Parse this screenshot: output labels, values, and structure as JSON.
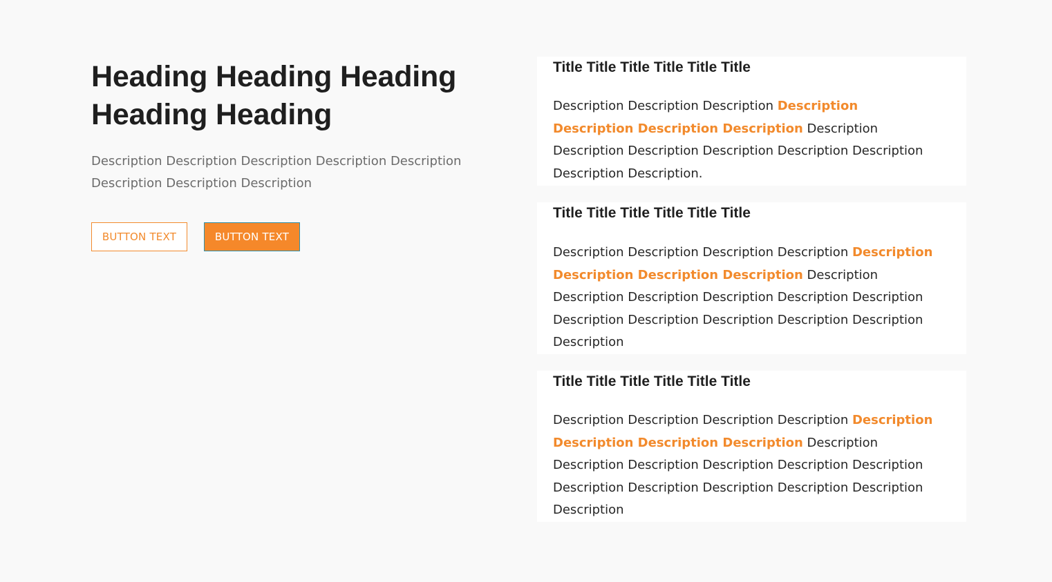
{
  "hero": {
    "heading": "Heading Heading Heading Heading Heading",
    "description": "Description Description Description Description Description Description Description Description",
    "button_outline_label": "BUTTON TEXT",
    "button_filled_label": "BUTTON TEXT"
  },
  "cards": [
    {
      "title": "Title Title Title Title Title Title",
      "desc_lead": "Description Description Description",
      "desc_highlight": "Description Description Description Description",
      "desc_rest": "Description Description Description Description Description Description Description Description."
    },
    {
      "title": "Title Title Title Title Title Title",
      "desc_lead": "Description Description Description Description",
      "desc_highlight": "Description Description Description Description",
      "desc_rest": "Description Description Description Description Description Description Description Description Description Description Description Description"
    },
    {
      "title": "Title Title Title Title Title Title",
      "desc_lead": "Description Description Description Description",
      "desc_highlight": "Description Description Description Description",
      "desc_rest": "Description Description Description Description Description Description Description Description Description Description Description Description"
    }
  ],
  "colors": {
    "accent": "#f28a2c",
    "background": "#f9f9f9",
    "card": "#ffffff",
    "text": "#1f1f1f"
  }
}
